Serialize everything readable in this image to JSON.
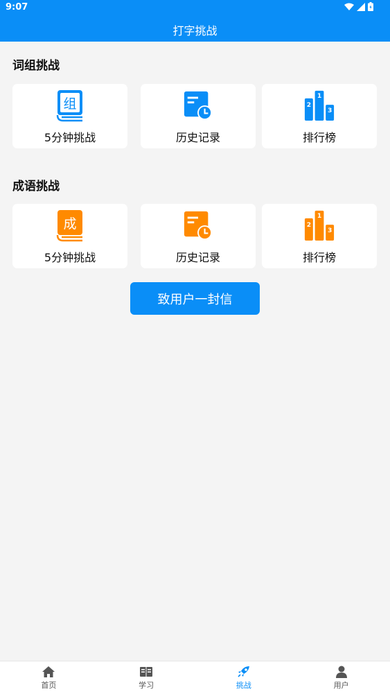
{
  "status": {
    "time": "9:07"
  },
  "header": {
    "title": "打字挑战"
  },
  "sections": [
    {
      "title": "词组挑战",
      "book_char": "组",
      "color": "#0a8ef7",
      "cards": [
        {
          "label": "5分钟挑战",
          "icon": "book-icon"
        },
        {
          "label": "历史记录",
          "icon": "history-icon"
        },
        {
          "label": "排行榜",
          "icon": "podium-icon"
        }
      ]
    },
    {
      "title": "成语挑战",
      "book_char": "成",
      "color": "#ff8a00",
      "cards": [
        {
          "label": "5分钟挑战",
          "icon": "book-icon"
        },
        {
          "label": "历史记录",
          "icon": "history-icon"
        },
        {
          "label": "排行榜",
          "icon": "podium-icon"
        }
      ]
    }
  ],
  "podium_ranks": [
    "1",
    "2",
    "3"
  ],
  "letter_button": {
    "label": "致用户一封信"
  },
  "tabs": [
    {
      "label": "首页",
      "icon": "home-icon",
      "active": false
    },
    {
      "label": "学习",
      "icon": "book-open-icon",
      "active": false
    },
    {
      "label": "挑战",
      "icon": "rocket-icon",
      "active": true
    },
    {
      "label": "用户",
      "icon": "user-icon",
      "active": false
    }
  ],
  "colors": {
    "accent": "#0a8ef7",
    "orange": "#ff8a00",
    "background": "#f4f4f4"
  }
}
